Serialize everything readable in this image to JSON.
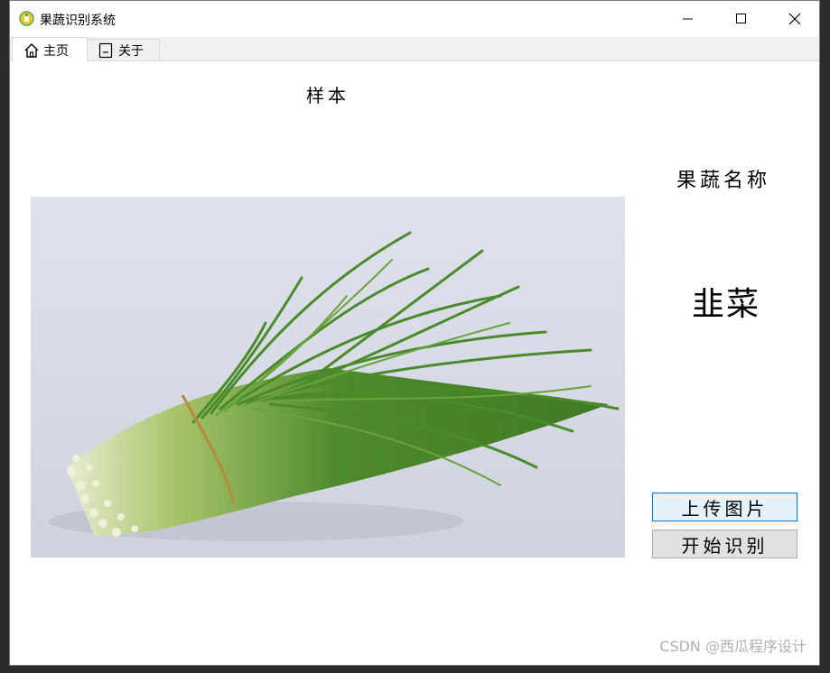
{
  "window": {
    "title": "果蔬识别系统",
    "controls": {
      "minimize_icon": "minimize-icon",
      "maximize_icon": "maximize-icon",
      "close_icon": "close-icon"
    }
  },
  "tabs": [
    {
      "label": "主页",
      "icon": "home-icon",
      "active": true
    },
    {
      "label": "关于",
      "icon": "document-icon",
      "active": false
    }
  ],
  "main": {
    "sample_label": "样本",
    "name_label": "果蔬名称",
    "result": "韭菜",
    "upload_button": "上传图片",
    "start_button": "开始识别"
  },
  "watermark": "CSDN @西瓜程序设计",
  "colors": {
    "upload_button_bg": "#e5f1fb",
    "upload_button_border": "#0078d7",
    "start_button_bg": "#e1e1e1",
    "produce_green": "#4f8a2e"
  }
}
